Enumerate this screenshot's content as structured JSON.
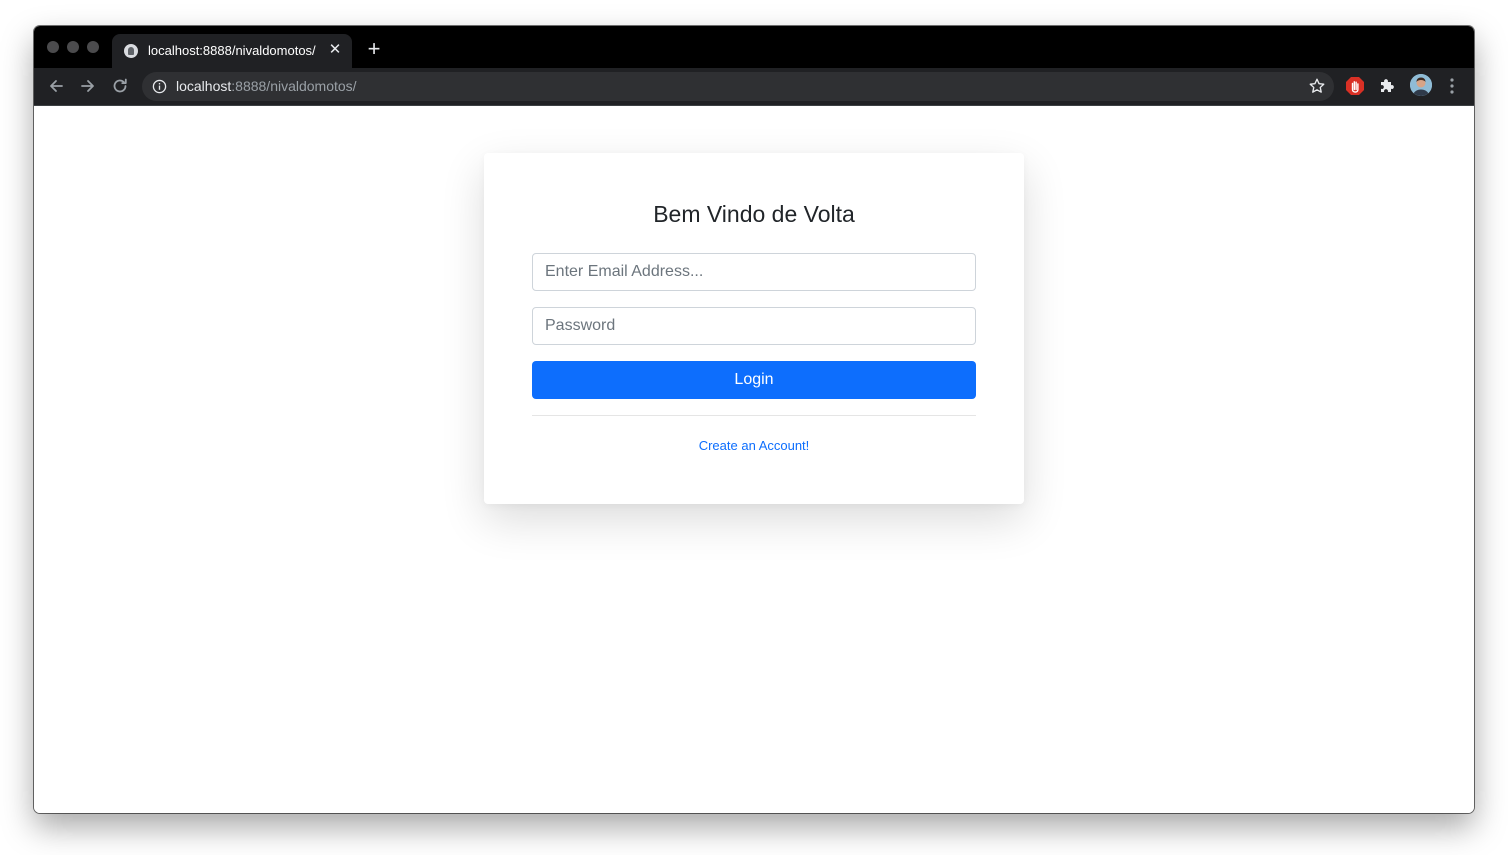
{
  "browser": {
    "tab_title": "localhost:8888/nivaldomotos/",
    "url_host": "localhost",
    "url_rest": ":8888/nivaldomotos/",
    "close_tab_glyph": "✕",
    "new_tab_glyph": "+"
  },
  "icons": {
    "back": "arrow-left-icon",
    "forward": "arrow-right-icon",
    "reload": "reload-icon",
    "info": "info-icon",
    "bookmark": "star-icon",
    "extension_blocker": "hand-icon",
    "extensions": "puzzle-icon",
    "menu": "kebab-menu-icon"
  },
  "login": {
    "title": "Bem Vindo de Volta",
    "email_placeholder": "Enter Email Address...",
    "password_placeholder": "Password",
    "login_label": "Login",
    "create_account_label": "Create an Account!"
  },
  "colors": {
    "primary": "#0d6efd",
    "chrome_dark": "#202124",
    "titlebar": "#000000",
    "ext_red": "#d93025"
  }
}
